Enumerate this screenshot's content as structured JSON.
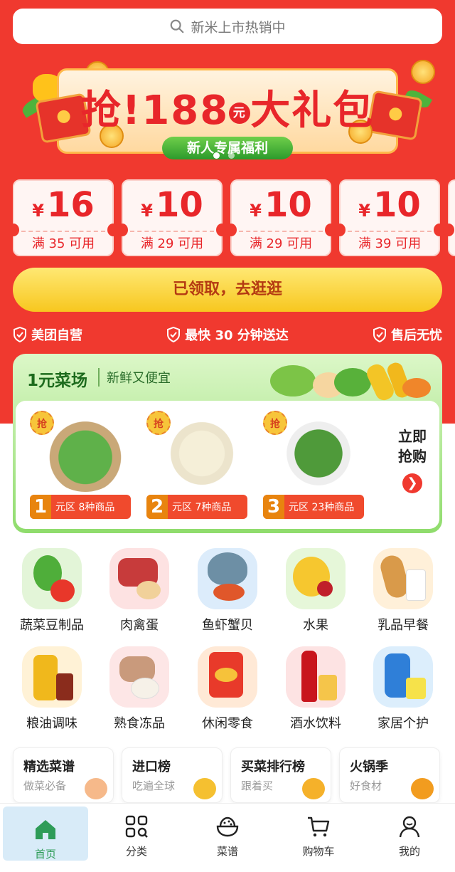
{
  "search": {
    "placeholder": "新米上市热销中",
    "icon": "search-icon"
  },
  "banner": {
    "title_prefix": "抢!",
    "amount": "188",
    "unit": "元",
    "title_suffix": "大礼包",
    "pill": "新人专属福利",
    "page_count": 2,
    "active_page": 1
  },
  "coupons": [
    {
      "currency": "¥",
      "amount": "16",
      "condition": "满 35 可用"
    },
    {
      "currency": "¥",
      "amount": "10",
      "condition": "满 29 可用"
    },
    {
      "currency": "¥",
      "amount": "10",
      "condition": "满 29 可用"
    },
    {
      "currency": "¥",
      "amount": "10",
      "condition": "满 39 可用"
    }
  ],
  "cta": {
    "label": "已领取，去逛逛"
  },
  "guarantees": [
    {
      "label": "美团自营",
      "icon": "shield-check-icon"
    },
    {
      "label": "最快 30 分钟送达",
      "icon": "shield-check-icon"
    },
    {
      "label": "售后无忧",
      "icon": "shield-check-icon"
    }
  ],
  "fresh": {
    "title": "1元菜场",
    "subtitle": "新鲜又便宜",
    "more_line1": "立即",
    "more_line2": "抢购",
    "deals": [
      {
        "tag": "抢",
        "zone_num": "1",
        "zone_unit": "元区",
        "count": "8种商品",
        "product": "bok-choy"
      },
      {
        "tag": "抢",
        "zone_num": "2",
        "zone_unit": "元区",
        "count": "7种商品",
        "product": "bean-sprouts"
      },
      {
        "tag": "抢",
        "zone_num": "3",
        "zone_unit": "元区",
        "count": "23种商品",
        "product": "green-beans"
      }
    ]
  },
  "categories": [
    {
      "label": "蔬菜豆制品",
      "icon": "vegetables-icon",
      "color": "#e3f5d8"
    },
    {
      "label": "肉禽蛋",
      "icon": "meat-icon",
      "color": "#fde2e2"
    },
    {
      "label": "鱼虾蟹贝",
      "icon": "seafood-icon",
      "color": "#dcecfb"
    },
    {
      "label": "水果",
      "icon": "fruit-icon",
      "color": "#e6f7d9"
    },
    {
      "label": "乳品早餐",
      "icon": "dairy-icon",
      "color": "#fff0d9"
    },
    {
      "label": "粮油调味",
      "icon": "oil-icon",
      "color": "#fff2d6"
    },
    {
      "label": "熟食冻品",
      "icon": "frozen-food-icon",
      "color": "#fde6e6"
    },
    {
      "label": "休闲零食",
      "icon": "snacks-icon",
      "color": "#ffe9d6"
    },
    {
      "label": "酒水饮料",
      "icon": "drinks-icon",
      "color": "#fde3e3"
    },
    {
      "label": "家居个护",
      "icon": "household-icon",
      "color": "#dceefc"
    }
  ],
  "recipes": [
    {
      "title": "精选菜谱",
      "sub": "做菜必备",
      "icon": "bowl-icon",
      "color": "#f6b98a"
    },
    {
      "title": "进口榜",
      "sub": "吃遍全球",
      "icon": "trophy-icon",
      "color": "#f5c030"
    },
    {
      "title": "买菜排行榜",
      "sub": "跟着买",
      "icon": "medal-icon",
      "color": "#f5b12a"
    },
    {
      "title": "火锅季",
      "sub": "好食材",
      "icon": "hotpot-icon",
      "color": "#f29c1f"
    }
  ],
  "tabs": [
    {
      "label": "首页",
      "icon": "home-icon",
      "active": true
    },
    {
      "label": "分类",
      "icon": "category-grid-icon",
      "active": false
    },
    {
      "label": "菜谱",
      "icon": "recipe-bowl-icon",
      "active": false
    },
    {
      "label": "购物车",
      "icon": "cart-icon",
      "active": false
    },
    {
      "label": "我的",
      "icon": "user-icon",
      "active": false
    }
  ],
  "colors": {
    "brand_red": "#f0392f",
    "accent_green": "#2e9c58",
    "coupon_red": "#e8262a",
    "cta_yellow": "#f7c71f"
  }
}
